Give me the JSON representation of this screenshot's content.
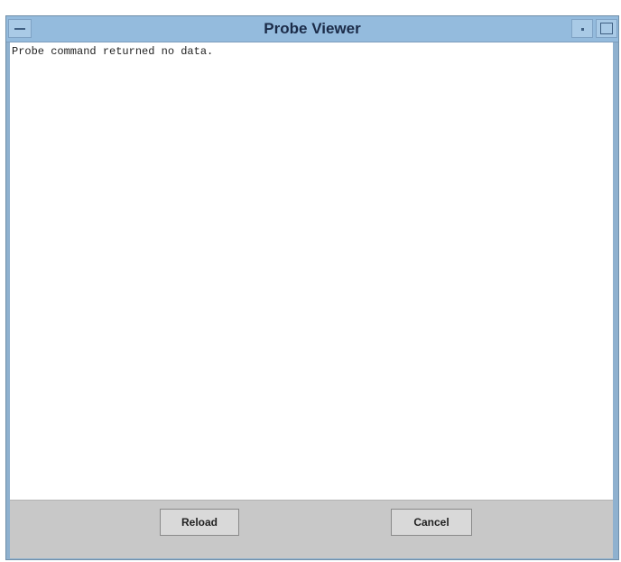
{
  "window": {
    "title": "Probe Viewer"
  },
  "content": {
    "message": "Probe command returned no data."
  },
  "buttons": {
    "reload": "Reload",
    "cancel": "Cancel"
  }
}
